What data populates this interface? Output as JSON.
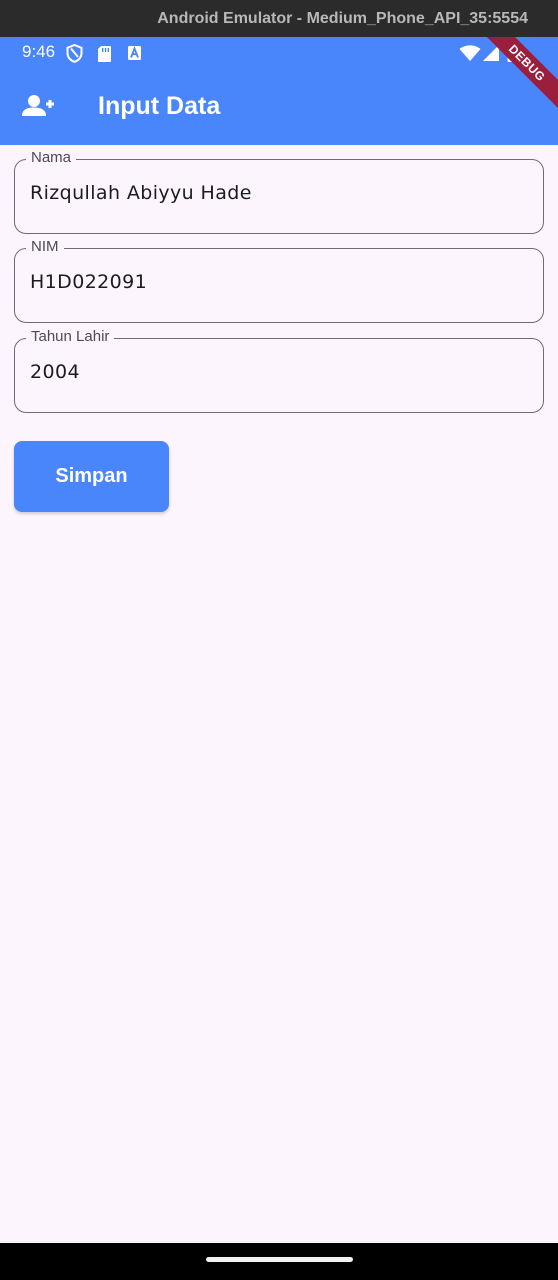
{
  "window": {
    "title": "Android Emulator - Medium_Phone_API_35:5554"
  },
  "status_bar": {
    "time": "9:46",
    "left_icons": [
      "shield-icon",
      "sd-card-icon",
      "font-a-icon"
    ],
    "right_icons": [
      "wifi-icon",
      "cell-signal-icon",
      "battery-icon"
    ]
  },
  "app_bar": {
    "icon": "person-add-icon",
    "title": "Input Data",
    "color": "#4a86fb",
    "debug_banner": "DEBUG"
  },
  "form": {
    "fields": [
      {
        "label": "Nama",
        "value": "Rizqullah Abiyyu Hade"
      },
      {
        "label": "NIM",
        "value": "H1D022091"
      },
      {
        "label": "Tahun Lahir",
        "value": "2004"
      }
    ],
    "submit_label": "Simpan"
  },
  "colors": {
    "primary": "#4a86fb",
    "background": "#fcf5fe",
    "debug": "#9a1f3e"
  }
}
